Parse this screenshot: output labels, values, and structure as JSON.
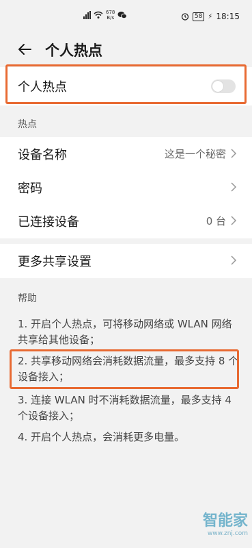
{
  "status": {
    "net_speed_value": "678",
    "net_speed_unit": "B/s",
    "battery": "58",
    "time": "18:15"
  },
  "header": {
    "title": "个人热点"
  },
  "hotspot": {
    "label": "个人热点",
    "enabled": false
  },
  "section_hotspot": "热点",
  "items": [
    {
      "label": "设备名称",
      "value": "这是一个秘密"
    },
    {
      "label": "密码",
      "value": ""
    },
    {
      "label": "已连接设备",
      "value": "0 台"
    }
  ],
  "more": {
    "label": "更多共享设置"
  },
  "help": {
    "title": "帮助",
    "lines": [
      "1. 开启个人热点，可将移动网络或 WLAN 网络共享给其他设备；",
      "2. 共享移动网络会消耗数据流量，最多支持 8 个设备接入；",
      "3. 连接 WLAN 时不消耗数据流量，最多支持 4 个设备接入；",
      "4. 开启个人热点，会消耗更多电量。"
    ]
  },
  "watermark": {
    "logo": "智能家",
    "url": "www.znj.com"
  },
  "colors": {
    "highlight": "#e86a32",
    "background": "#f2f2f2"
  }
}
